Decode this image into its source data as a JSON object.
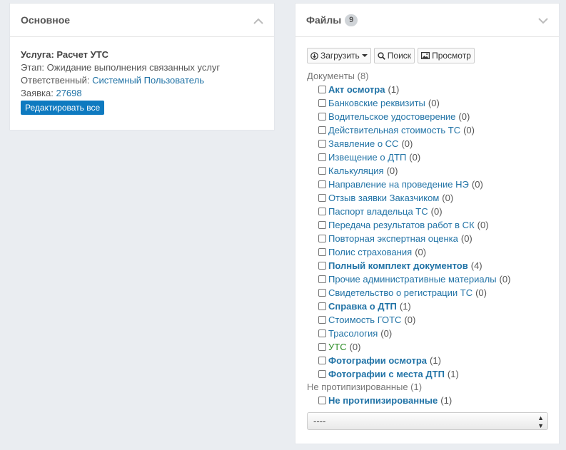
{
  "main_panel": {
    "title": "Основное",
    "service_label": "Услуга: Расчет УТС",
    "stage_label": "Этап:",
    "stage_value": "Ожидание выполнения связанных услуг",
    "responsible_label": "Ответственный:",
    "responsible_value": "Системный Пользователь",
    "request_label": "Заявка:",
    "request_value": "27698",
    "edit_all_label": "Редактировать все"
  },
  "files_panel": {
    "title": "Файлы",
    "count": "9",
    "toolbar": {
      "upload": "Загрузить",
      "search": "Поиск",
      "preview": "Просмотр"
    },
    "groups": [
      {
        "label": "Документы (8)",
        "items": [
          {
            "name": "Акт осмотра",
            "count": "(1)",
            "style": "bold"
          },
          {
            "name": "Банковские реквизиты",
            "count": "(0)",
            "style": ""
          },
          {
            "name": "Водительское удостоверение",
            "count": "(0)",
            "style": ""
          },
          {
            "name": "Действительная стоимость ТС",
            "count": "(0)",
            "style": ""
          },
          {
            "name": "Заявление о СС",
            "count": "(0)",
            "style": ""
          },
          {
            "name": "Извещение о ДТП",
            "count": "(0)",
            "style": ""
          },
          {
            "name": "Калькуляция",
            "count": "(0)",
            "style": ""
          },
          {
            "name": "Направление на проведение НЭ",
            "count": "(0)",
            "style": ""
          },
          {
            "name": "Отзыв заявки Заказчиком",
            "count": "(0)",
            "style": ""
          },
          {
            "name": "Паспорт владельца ТС",
            "count": "(0)",
            "style": ""
          },
          {
            "name": "Передача результатов работ в СК",
            "count": "(0)",
            "style": ""
          },
          {
            "name": "Повторная экспертная оценка",
            "count": "(0)",
            "style": ""
          },
          {
            "name": "Полис страхования",
            "count": "(0)",
            "style": ""
          },
          {
            "name": "Полный комплект документов",
            "count": "(4)",
            "style": "bold"
          },
          {
            "name": "Прочие административные материалы",
            "count": "(0)",
            "style": ""
          },
          {
            "name": "Свидетельство о регистрации ТС",
            "count": "(0)",
            "style": ""
          },
          {
            "name": "Справка о ДТП",
            "count": "(1)",
            "style": "bold"
          },
          {
            "name": "Стоимость ГОТС",
            "count": "(0)",
            "style": ""
          },
          {
            "name": "Трасология",
            "count": "(0)",
            "style": ""
          },
          {
            "name": "УТС",
            "count": "(0)",
            "style": "green"
          },
          {
            "name": "Фотографии осмотра",
            "count": "(1)",
            "style": "bold"
          },
          {
            "name": "Фотографии с места ДТП",
            "count": "(1)",
            "style": "bold"
          }
        ]
      },
      {
        "label": "Не протипизированные (1)",
        "items": [
          {
            "name": "Не протипизированные",
            "count": "(1)",
            "style": "bold"
          }
        ]
      }
    ],
    "select_value": "----"
  },
  "icons": {
    "collapse": "chevron-up-icon",
    "expand": "chevron-down-icon",
    "upload": "download-circle-icon",
    "search": "magnifier-icon",
    "preview": "picture-icon"
  },
  "colors": {
    "link": "#2173a6",
    "primary_button": "#0e7ac0",
    "utc_green": "#2b8c25",
    "background": "#eaedf1"
  }
}
